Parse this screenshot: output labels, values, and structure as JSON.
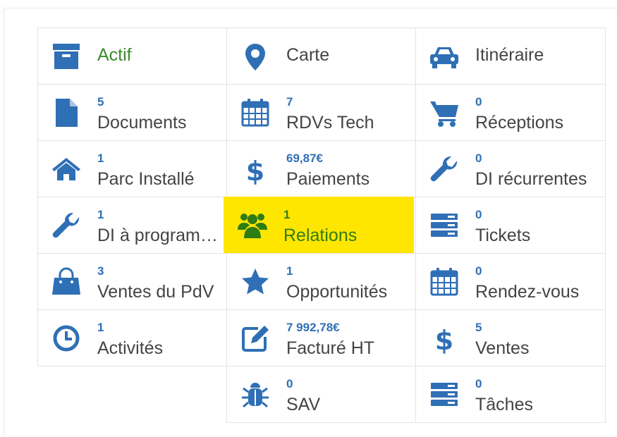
{
  "colors": {
    "icon_blue": "#2f6fb5",
    "highlight": "#ffe600",
    "active_green": "#3b8b2e",
    "relations_icon": "#2e7d12"
  },
  "tiles": [
    {
      "name": "actif",
      "icon": "archive-box-icon",
      "count": "",
      "label": "Actif"
    },
    {
      "name": "carte",
      "icon": "map-marker-icon",
      "count": "",
      "label": "Carte"
    },
    {
      "name": "itineraire",
      "icon": "car-icon",
      "count": "",
      "label": "Itinéraire"
    },
    {
      "name": "documents",
      "icon": "document-icon",
      "count": "5",
      "label": "Documents"
    },
    {
      "name": "rdvs-tech",
      "icon": "calendar-icon",
      "count": "7",
      "label": "RDVs Tech"
    },
    {
      "name": "receptions",
      "icon": "cart-icon",
      "count": "0",
      "label": "Réceptions"
    },
    {
      "name": "parc-installe",
      "icon": "home-icon",
      "count": "1",
      "label": "Parc Installé"
    },
    {
      "name": "paiements",
      "icon": "dollar-icon",
      "count": "69,87€",
      "label": "Paiements"
    },
    {
      "name": "di-recurrentes",
      "icon": "wrench-icon",
      "count": "0",
      "label": "DI récurrentes"
    },
    {
      "name": "di-a-programmer",
      "icon": "wrench-icon",
      "count": "1",
      "label": "DI à program…"
    },
    {
      "name": "relations",
      "icon": "users-icon",
      "count": "1",
      "label": "Relations"
    },
    {
      "name": "tickets",
      "icon": "server-icon",
      "count": "0",
      "label": "Tickets"
    },
    {
      "name": "ventes-du-pdv",
      "icon": "shopping-bag-icon",
      "count": "3",
      "label": "Ventes du PdV"
    },
    {
      "name": "opportunites",
      "icon": "star-icon",
      "count": "1",
      "label": "Opportunités"
    },
    {
      "name": "rendez-vous",
      "icon": "calendar-icon",
      "count": "0",
      "label": "Rendez-vous"
    },
    {
      "name": "activites",
      "icon": "clock-icon",
      "count": "1",
      "label": "Activités"
    },
    {
      "name": "facture-ht",
      "icon": "edit-icon",
      "count": "7 992,78€",
      "label": "Facturé HT"
    },
    {
      "name": "ventes",
      "icon": "dollar-icon",
      "count": "5",
      "label": "Ventes"
    },
    {
      "name": "sav",
      "icon": "bug-icon",
      "count": "0",
      "label": "SAV"
    },
    {
      "name": "taches",
      "icon": "server-icon",
      "count": "0",
      "label": "Tâches"
    }
  ]
}
